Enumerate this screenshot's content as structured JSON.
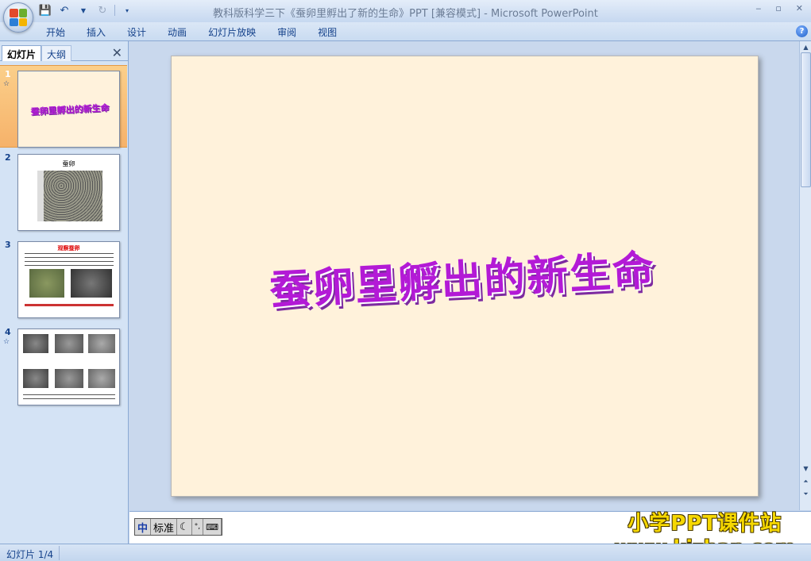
{
  "window": {
    "title": "教科版科学三下《蚕卵里孵出了新的生命》PPT [兼容模式] - Microsoft PowerPoint",
    "controls": [
      "‒",
      "▫",
      "✕"
    ]
  },
  "ribbon": {
    "tabs": [
      "开始",
      "插入",
      "设计",
      "动画",
      "幻灯片放映",
      "审阅",
      "视图"
    ]
  },
  "left_panel": {
    "tab_slides": "幻灯片",
    "tab_outline": "大纲",
    "close": "✕",
    "thumbs": [
      {
        "num": "1",
        "title": "蚕卵里孵出的新生命"
      },
      {
        "num": "2",
        "title": "蚕卵"
      },
      {
        "num": "3",
        "title": "观察蚕卵"
      },
      {
        "num": "4",
        "title": ""
      }
    ]
  },
  "slide": {
    "title": "蚕卵里孵出的新生命"
  },
  "ime": {
    "icon": "中",
    "mode": "标准"
  },
  "watermark": {
    "line1": "小学PPT课件站",
    "line2": "www.kjzhan.com"
  },
  "status": {
    "slide_counter": "幻灯片 1/4"
  },
  "colors": {
    "accent": "#15428b",
    "slide_bg": "#fff2db",
    "title_purple": "#b31ad6",
    "selected_thumb": "#f6b26a"
  }
}
